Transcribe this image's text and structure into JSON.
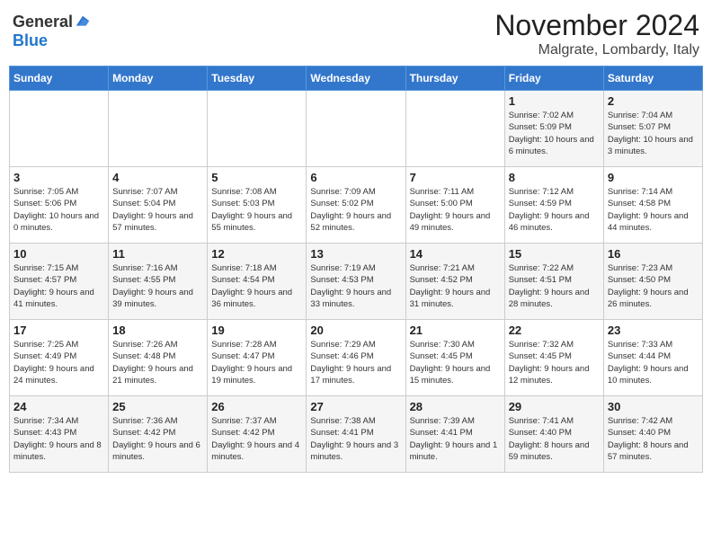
{
  "logo": {
    "general": "General",
    "blue": "Blue"
  },
  "title": {
    "month": "November 2024",
    "location": "Malgrate, Lombardy, Italy"
  },
  "weekdays": [
    "Sunday",
    "Monday",
    "Tuesday",
    "Wednesday",
    "Thursday",
    "Friday",
    "Saturday"
  ],
  "weeks": [
    [
      {
        "day": "",
        "info": ""
      },
      {
        "day": "",
        "info": ""
      },
      {
        "day": "",
        "info": ""
      },
      {
        "day": "",
        "info": ""
      },
      {
        "day": "",
        "info": ""
      },
      {
        "day": "1",
        "info": "Sunrise: 7:02 AM\nSunset: 5:09 PM\nDaylight: 10 hours and 6 minutes."
      },
      {
        "day": "2",
        "info": "Sunrise: 7:04 AM\nSunset: 5:07 PM\nDaylight: 10 hours and 3 minutes."
      }
    ],
    [
      {
        "day": "3",
        "info": "Sunrise: 7:05 AM\nSunset: 5:06 PM\nDaylight: 10 hours and 0 minutes."
      },
      {
        "day": "4",
        "info": "Sunrise: 7:07 AM\nSunset: 5:04 PM\nDaylight: 9 hours and 57 minutes."
      },
      {
        "day": "5",
        "info": "Sunrise: 7:08 AM\nSunset: 5:03 PM\nDaylight: 9 hours and 55 minutes."
      },
      {
        "day": "6",
        "info": "Sunrise: 7:09 AM\nSunset: 5:02 PM\nDaylight: 9 hours and 52 minutes."
      },
      {
        "day": "7",
        "info": "Sunrise: 7:11 AM\nSunset: 5:00 PM\nDaylight: 9 hours and 49 minutes."
      },
      {
        "day": "8",
        "info": "Sunrise: 7:12 AM\nSunset: 4:59 PM\nDaylight: 9 hours and 46 minutes."
      },
      {
        "day": "9",
        "info": "Sunrise: 7:14 AM\nSunset: 4:58 PM\nDaylight: 9 hours and 44 minutes."
      }
    ],
    [
      {
        "day": "10",
        "info": "Sunrise: 7:15 AM\nSunset: 4:57 PM\nDaylight: 9 hours and 41 minutes."
      },
      {
        "day": "11",
        "info": "Sunrise: 7:16 AM\nSunset: 4:55 PM\nDaylight: 9 hours and 39 minutes."
      },
      {
        "day": "12",
        "info": "Sunrise: 7:18 AM\nSunset: 4:54 PM\nDaylight: 9 hours and 36 minutes."
      },
      {
        "day": "13",
        "info": "Sunrise: 7:19 AM\nSunset: 4:53 PM\nDaylight: 9 hours and 33 minutes."
      },
      {
        "day": "14",
        "info": "Sunrise: 7:21 AM\nSunset: 4:52 PM\nDaylight: 9 hours and 31 minutes."
      },
      {
        "day": "15",
        "info": "Sunrise: 7:22 AM\nSunset: 4:51 PM\nDaylight: 9 hours and 28 minutes."
      },
      {
        "day": "16",
        "info": "Sunrise: 7:23 AM\nSunset: 4:50 PM\nDaylight: 9 hours and 26 minutes."
      }
    ],
    [
      {
        "day": "17",
        "info": "Sunrise: 7:25 AM\nSunset: 4:49 PM\nDaylight: 9 hours and 24 minutes."
      },
      {
        "day": "18",
        "info": "Sunrise: 7:26 AM\nSunset: 4:48 PM\nDaylight: 9 hours and 21 minutes."
      },
      {
        "day": "19",
        "info": "Sunrise: 7:28 AM\nSunset: 4:47 PM\nDaylight: 9 hours and 19 minutes."
      },
      {
        "day": "20",
        "info": "Sunrise: 7:29 AM\nSunset: 4:46 PM\nDaylight: 9 hours and 17 minutes."
      },
      {
        "day": "21",
        "info": "Sunrise: 7:30 AM\nSunset: 4:45 PM\nDaylight: 9 hours and 15 minutes."
      },
      {
        "day": "22",
        "info": "Sunrise: 7:32 AM\nSunset: 4:45 PM\nDaylight: 9 hours and 12 minutes."
      },
      {
        "day": "23",
        "info": "Sunrise: 7:33 AM\nSunset: 4:44 PM\nDaylight: 9 hours and 10 minutes."
      }
    ],
    [
      {
        "day": "24",
        "info": "Sunrise: 7:34 AM\nSunset: 4:43 PM\nDaylight: 9 hours and 8 minutes."
      },
      {
        "day": "25",
        "info": "Sunrise: 7:36 AM\nSunset: 4:42 PM\nDaylight: 9 hours and 6 minutes."
      },
      {
        "day": "26",
        "info": "Sunrise: 7:37 AM\nSunset: 4:42 PM\nDaylight: 9 hours and 4 minutes."
      },
      {
        "day": "27",
        "info": "Sunrise: 7:38 AM\nSunset: 4:41 PM\nDaylight: 9 hours and 3 minutes."
      },
      {
        "day": "28",
        "info": "Sunrise: 7:39 AM\nSunset: 4:41 PM\nDaylight: 9 hours and 1 minute."
      },
      {
        "day": "29",
        "info": "Sunrise: 7:41 AM\nSunset: 4:40 PM\nDaylight: 8 hours and 59 minutes."
      },
      {
        "day": "30",
        "info": "Sunrise: 7:42 AM\nSunset: 4:40 PM\nDaylight: 8 hours and 57 minutes."
      }
    ]
  ]
}
